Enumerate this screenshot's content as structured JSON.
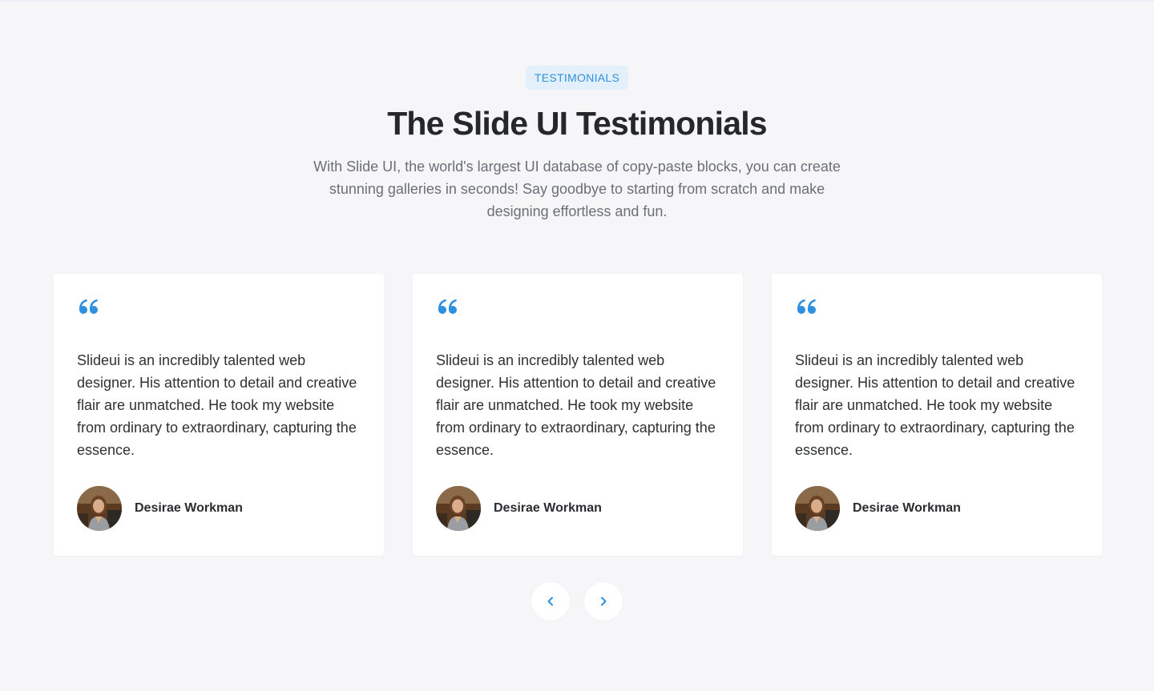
{
  "section": {
    "badge": "TESTIMONIALS",
    "title": "The Slide UI Testimonials",
    "subtitle": "With Slide UI, the world's largest UI database of copy-paste blocks, you can create stunning galleries in seconds! Say goodbye to starting from scratch and make designing effortless and fun."
  },
  "testimonials": [
    {
      "quote_icon": "quote-icon",
      "text": "Slideui is an incredibly talented web designer. His attention to detail and creative flair are unmatched. He took my website from ordinary to extraordinary, capturing the essence.",
      "author": "Desirae Workman"
    },
    {
      "quote_icon": "quote-icon",
      "text": "Slideui is an incredibly talented web designer. His attention to detail and creative flair are unmatched. He took my website from ordinary to extraordinary, capturing the essence.",
      "author": "Desirae Workman"
    },
    {
      "quote_icon": "quote-icon",
      "text": "Slideui is an incredibly talented web designer. His attention to detail and creative flair are unmatched. He took my website from ordinary to extraordinary, capturing the essence.",
      "author": "Desirae Workman"
    }
  ],
  "navigation": {
    "prev_icon": "chevron-left-icon",
    "next_icon": "chevron-right-icon"
  },
  "colors": {
    "accent": "#2f8fe0",
    "badge_bg": "#e3f0fb",
    "page_bg": "#f6f6f8",
    "card_bg": "#ffffff"
  }
}
